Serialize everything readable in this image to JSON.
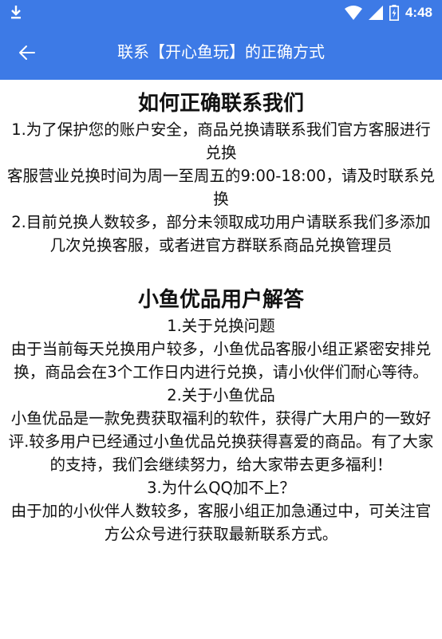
{
  "status_bar": {
    "time": "4:48",
    "icons": [
      "download-icon",
      "wifi-icon",
      "cellular-signal-icon",
      "battery-charging-icon"
    ]
  },
  "app_bar": {
    "title": "联系【开心鱼玩】的正确方式",
    "back_icon": "arrow-left-icon"
  },
  "colors": {
    "primary": "#3d7ae6",
    "text": "#111111",
    "background": "#ffffff"
  },
  "sections": [
    {
      "heading": "如何正确联系我们",
      "paragraphs": [
        "1.为了保护您的账户安全，商品兑换请联系我们官方客服进行兑换",
        "客服营业兑换时间为周一至周五的9:00-18:00，请及时联系兑换",
        "2.目前兑换人数较多，部分未领取成功用户请联系我们多添加几次兑换客服，或者进官方群联系商品兑换管理员"
      ]
    },
    {
      "heading": "小鱼优品用户解答",
      "paragraphs": [
        "1.关于兑换问题",
        "由于当前每天兑换用户较多，小鱼优品客服小组正紧密安排兑换，商品会在3个工作日内进行兑换，请小伙伴们耐心等待。",
        "2.关于小鱼优品",
        "小鱼优品是一款免费获取福利的软件，获得广大用户的一致好评.较多用户已经通过小鱼优品兑换获得喜爱的商品。有了大家的支持，我们会继续努力，给大家带去更多福利！",
        "3.为什么QQ加不上？",
        "由于加的小伙伴人数较多，客服小组正加急通过中，可关注官方公众号进行获取最新联系方式。"
      ]
    }
  ]
}
